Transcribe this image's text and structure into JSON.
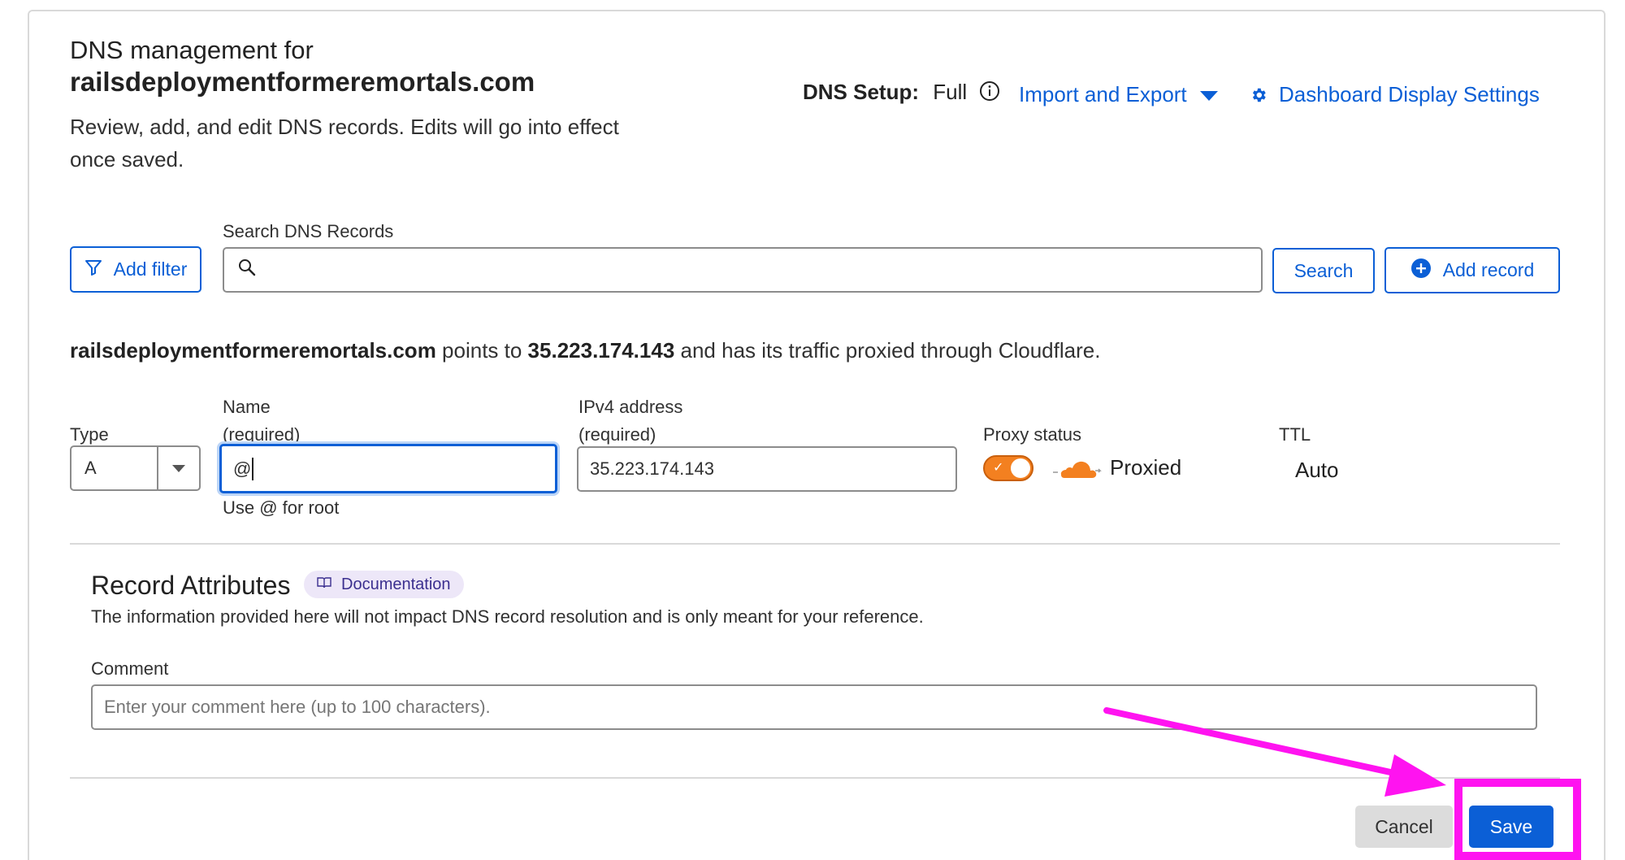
{
  "header": {
    "title_line1": "DNS management for",
    "title_domain": "railsdeploymentformeremortals.com",
    "description": "Review, add, and edit DNS records. Edits will go into effect once saved."
  },
  "toolbar": {
    "dns_setup_label": "DNS Setup:",
    "dns_setup_value": "Full",
    "import_export_label": "Import and Export",
    "dashboard_settings_label": "Dashboard Display Settings"
  },
  "search": {
    "label": "Search DNS Records",
    "placeholder": "",
    "add_filter_label": "Add filter",
    "search_button_label": "Search",
    "add_record_label": "Add record"
  },
  "info_line": {
    "domain": "railsdeploymentformeremortals.com",
    "text_points_to": " points to ",
    "ip": "35.223.174.143",
    "text_rest": " and has its traffic proxied through Cloudflare."
  },
  "record_form": {
    "type_label": "Type",
    "type_value": "A",
    "name_label": "Name",
    "name_required": "(required)",
    "name_value": "@",
    "name_hint": "Use @ for root",
    "ipv4_label": "IPv4 address",
    "ipv4_required": "(required)",
    "ipv4_value": "35.223.174.143",
    "proxy_label": "Proxy status",
    "proxy_value": "Proxied",
    "proxy_enabled": true,
    "ttl_label": "TTL",
    "ttl_value": "Auto"
  },
  "attributes": {
    "title": "Record Attributes",
    "doc_label": "Documentation",
    "description": "The information provided here will not impact DNS record resolution and is only meant for your reference.",
    "comment_label": "Comment",
    "comment_placeholder": "Enter your comment here (up to 100 characters)."
  },
  "actions": {
    "cancel_label": "Cancel",
    "save_label": "Save"
  },
  "colors": {
    "accent": "#0b5fd6",
    "cloudflare_orange": "#f38020",
    "annotation_magenta": "#ff13f0"
  },
  "icons": [
    "info-icon",
    "caret-down-icon",
    "gear-icon",
    "filter-icon",
    "search-icon",
    "plus-circle-icon",
    "chevron-down-icon",
    "check-icon",
    "cloud-icon",
    "book-icon",
    "annotation-arrow"
  ]
}
